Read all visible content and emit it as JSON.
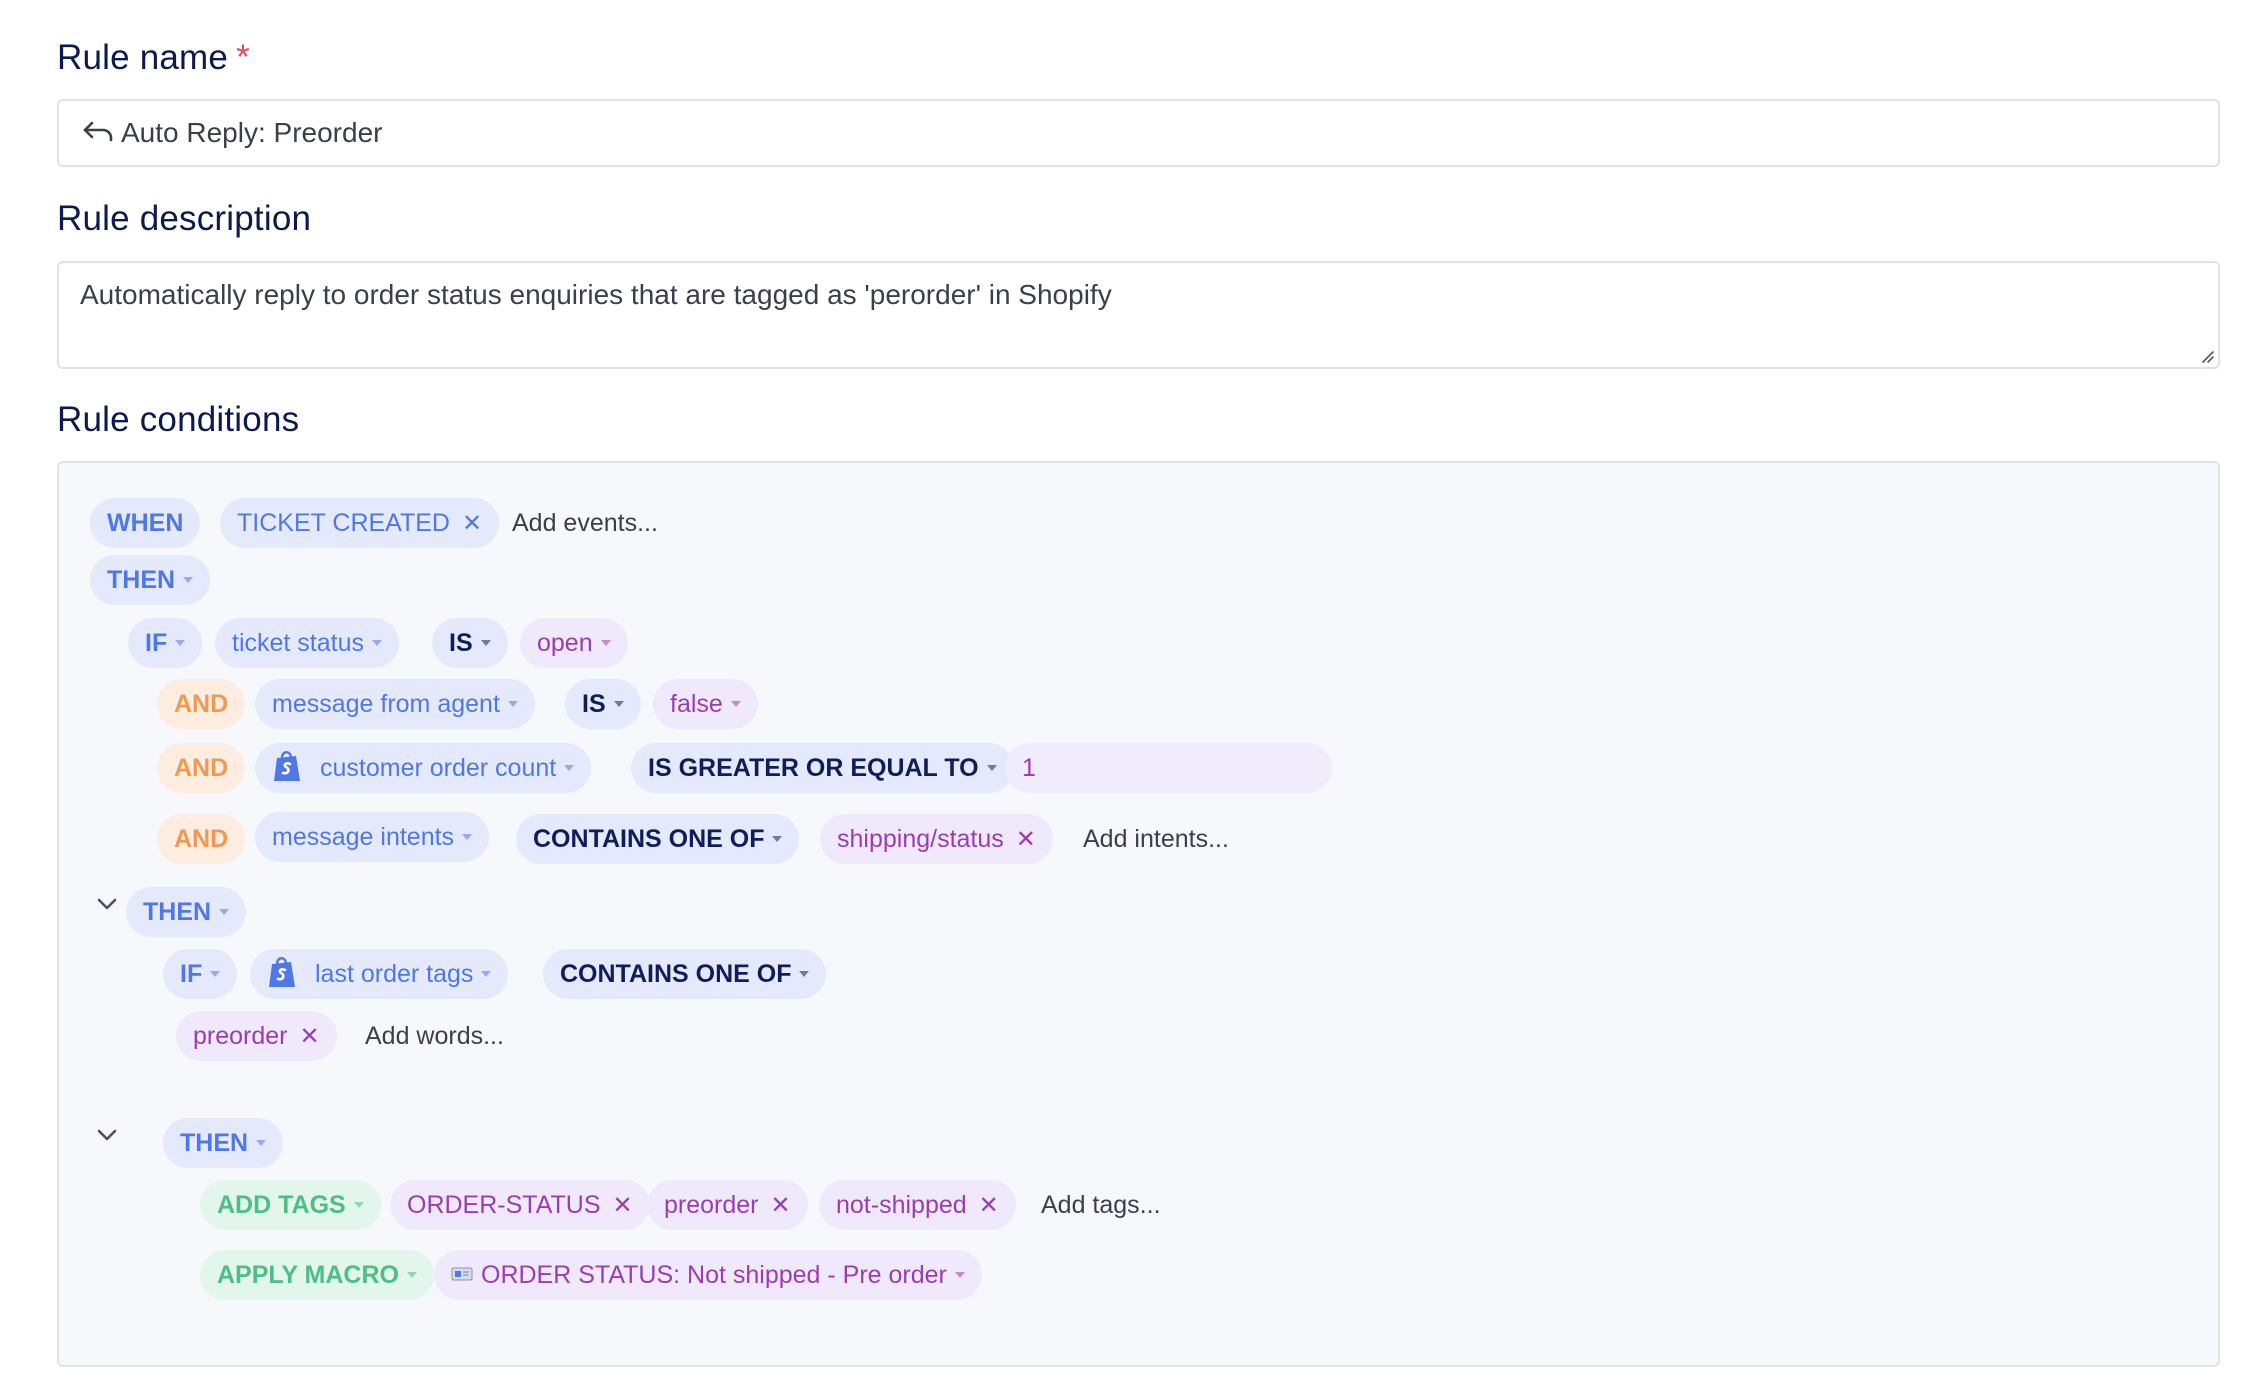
{
  "rule_name": {
    "label": "Rule name",
    "required_mark": "*",
    "value": "Auto Reply: Preorder",
    "icon": "reply-arrow-icon"
  },
  "rule_description": {
    "label": "Rule description",
    "value": "Automatically reply to order status enquiries that are tagged as 'perorder' in Shopify"
  },
  "rule_conditions": {
    "label": "Rule conditions",
    "when": {
      "keyword": "WHEN",
      "event": "TICKET CREATED",
      "add_placeholder": "Add events..."
    },
    "then1": "THEN",
    "if1": {
      "keyword": "IF",
      "field": "ticket status",
      "operator": "IS",
      "value": "open"
    },
    "and1": {
      "keyword": "AND",
      "field": "message from agent",
      "operator": "IS",
      "value": "false"
    },
    "and2": {
      "keyword": "AND",
      "field": "customer order count",
      "operator": "IS GREATER OR EQUAL TO",
      "value": "1"
    },
    "and3": {
      "keyword": "AND",
      "field": "message intents",
      "operator": "CONTAINS ONE OF",
      "value": "shipping/status",
      "add_placeholder": "Add intents..."
    },
    "then2": "THEN",
    "if2": {
      "keyword": "IF",
      "field": "last order tags",
      "operator": "CONTAINS ONE OF",
      "value": "preorder",
      "add_placeholder": "Add words..."
    },
    "then3": "THEN",
    "add_tags": {
      "action": "ADD TAGS",
      "tags": [
        "ORDER-STATUS",
        "preorder",
        "not-shipped"
      ],
      "add_placeholder": "Add tags..."
    },
    "apply_macro": {
      "action": "APPLY MACRO",
      "macro": "ORDER STATUS: Not shipped - Pre order"
    }
  },
  "colors": {
    "heading": "#0c1a4d",
    "blue": "#5077e6",
    "purple": "#9a3db0",
    "orange": "#ef9a53",
    "green": "#4cbe86",
    "navy": "#0f1d5a"
  }
}
